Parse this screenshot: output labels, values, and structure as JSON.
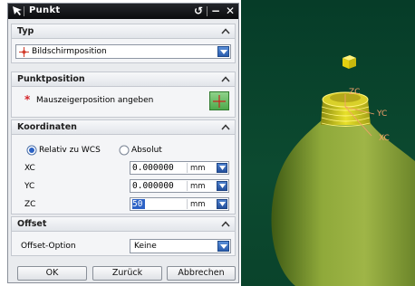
{
  "dialog": {
    "title": "Punkt",
    "controls": {
      "reset": "↺",
      "minimize": "−",
      "close": "✕"
    },
    "typ": {
      "header": "Typ",
      "selected": "Bildschirmposition"
    },
    "punktposition": {
      "header": "Punktposition",
      "required_marker": "*",
      "instruction": "Mauszeigerposition angeben"
    },
    "koordinaten": {
      "header": "Koordinaten",
      "options": {
        "relative": "Relativ zu WCS",
        "absolute": "Absolut"
      },
      "selected_option": "Relativ zu WCS",
      "rows": [
        {
          "label": "XC",
          "value": "0.000000",
          "unit": "mm"
        },
        {
          "label": "YC",
          "value": "0.000000",
          "unit": "mm"
        },
        {
          "label": "ZC",
          "value": "50",
          "unit": "mm"
        }
      ]
    },
    "offset": {
      "header": "Offset",
      "option_label": "Offset-Option",
      "selected": "Keine"
    },
    "buttons": {
      "ok": "OK",
      "back": "Zurück",
      "cancel": "Abbrechen"
    }
  },
  "viewport": {
    "axis_labels": {
      "zc": "ZC",
      "yc": "YC",
      "xc": "XC"
    },
    "colors": {
      "background": "#0c4a30",
      "model": "#88a335",
      "neck": "#d8d21e",
      "axis_label": "#f2a06a"
    }
  }
}
